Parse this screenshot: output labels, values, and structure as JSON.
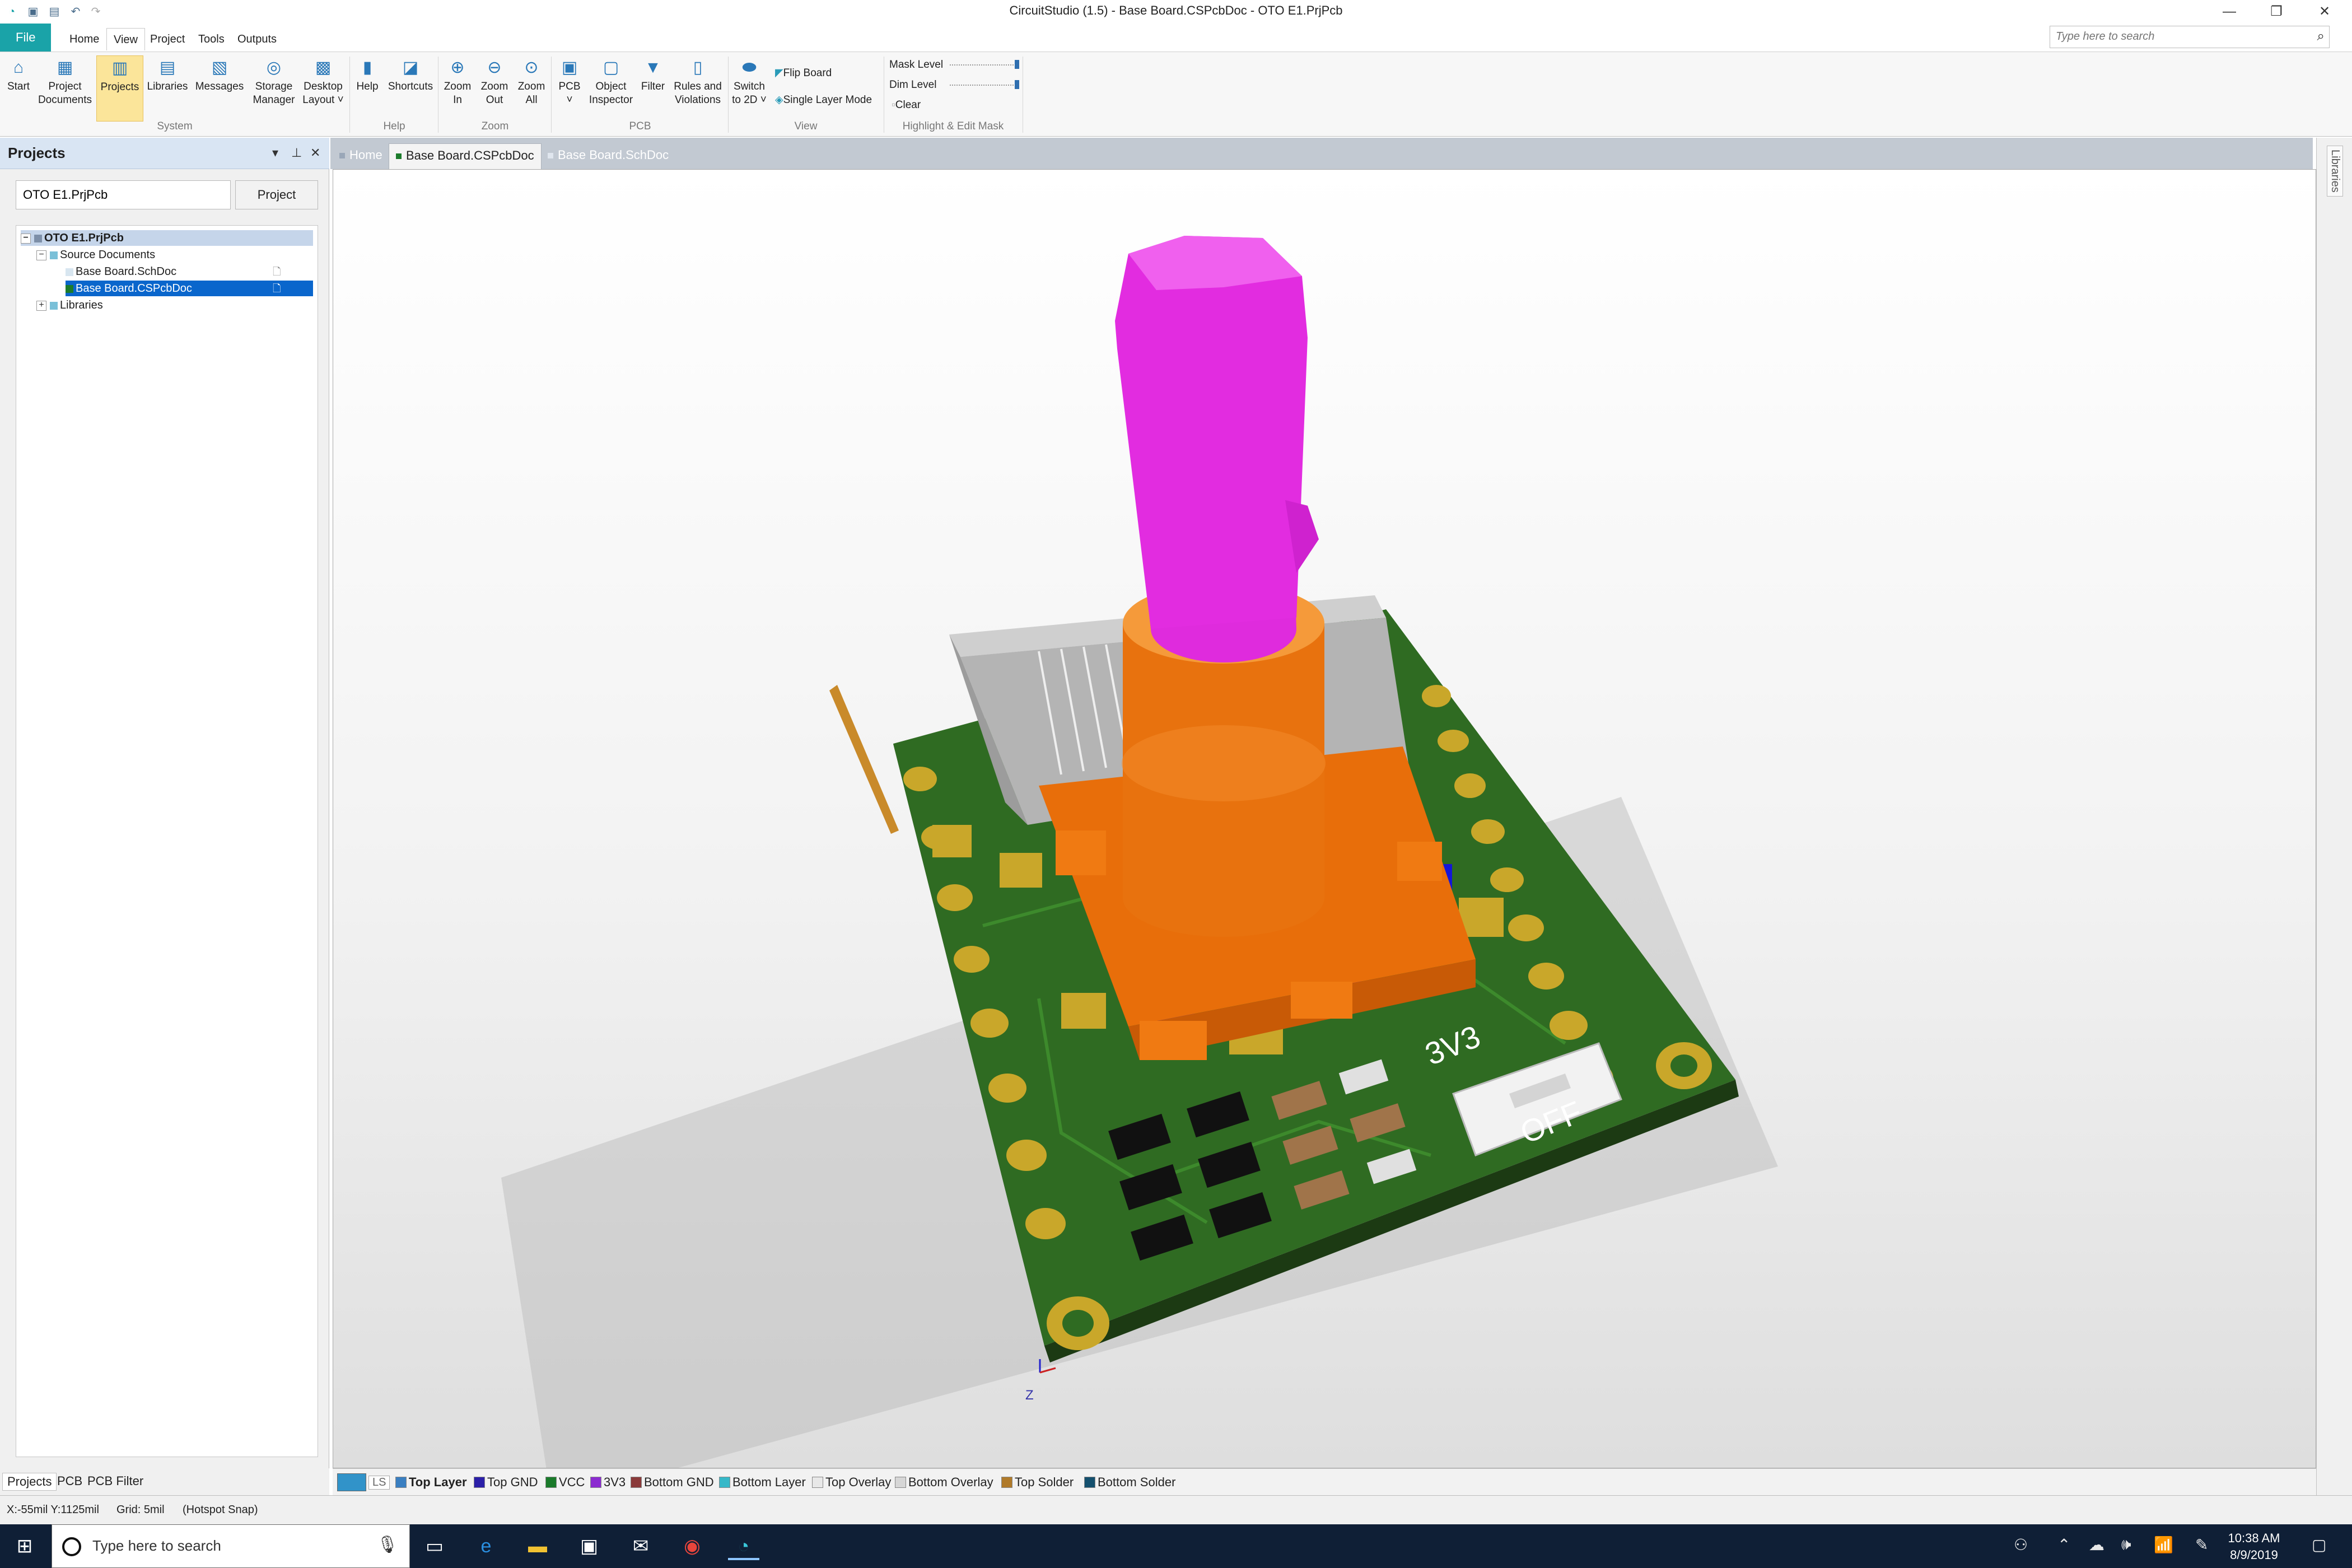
{
  "window": {
    "title": "CircuitStudio (1.5) - Base Board.CSPcbDoc - OTO E1.PrjPcb",
    "controls": [
      "minimize-icon",
      "restore-icon",
      "close-icon"
    ]
  },
  "quick_access": [
    "app-logo-icon",
    "new-icon",
    "save-icon",
    "undo-icon",
    "redo-icon"
  ],
  "menu": {
    "file": "File",
    "tabs": [
      "Home",
      "View",
      "Project",
      "Tools",
      "Outputs"
    ],
    "active_tab": "View"
  },
  "search": {
    "placeholder": "Type here to search"
  },
  "ribbon": {
    "buttons": [
      {
        "label": "Start",
        "icon": "home-icon"
      },
      {
        "label": "Project\nDocuments",
        "icon": "documents-icon"
      },
      {
        "label": "Projects",
        "icon": "projects-icon",
        "active": true
      },
      {
        "label": "Libraries",
        "icon": "libraries-icon"
      },
      {
        "label": "Messages",
        "icon": "messages-icon"
      },
      {
        "label": "Storage\nManager",
        "icon": "storage-icon"
      },
      {
        "label": "Desktop\nLayout ˅",
        "icon": "layout-icon"
      },
      {
        "label": "Help",
        "icon": "help-icon"
      },
      {
        "label": "Shortcuts",
        "icon": "shortcuts-icon"
      },
      {
        "label": "Zoom\nIn",
        "icon": "zoom-in-icon"
      },
      {
        "label": "Zoom\nOut",
        "icon": "zoom-out-icon"
      },
      {
        "label": "Zoom\nAll",
        "icon": "zoom-all-icon"
      },
      {
        "label": "PCB\n˅",
        "icon": "pcb-icon"
      },
      {
        "label": "Object\nInspector",
        "icon": "inspector-icon"
      },
      {
        "label": "Filter",
        "icon": "filter-icon"
      },
      {
        "label": "Rules and\nViolations",
        "icon": "rules-icon"
      },
      {
        "label": "Switch\nto 2D ˅",
        "icon": "switch-2d-icon"
      }
    ],
    "view_options": {
      "flip_board": "Flip Board",
      "single_layer_mode": "Single Layer Mode"
    },
    "mask": {
      "mask_level": "Mask Level",
      "dim_level": "Dim Level",
      "clear": "Clear"
    },
    "groups": [
      "System",
      "Help",
      "Zoom",
      "PCB",
      "View",
      "Highlight & Edit Mask"
    ]
  },
  "projects_panel": {
    "title": "Projects",
    "project_field_value": "OTO E1.PrjPcb",
    "project_button": "Project",
    "tree": {
      "root": "OTO E1.PrjPcb",
      "source_documents": "Source Documents",
      "docs": [
        "Base Board.SchDoc",
        "Base Board.CSPcbDoc"
      ],
      "libraries": "Libraries"
    },
    "bottom_tabs": [
      "Projects",
      "PCB",
      "PCB Filter"
    ]
  },
  "doc_tabs": [
    "Home",
    "Base Board.CSPcbDoc",
    "Base Board.SchDoc"
  ],
  "active_doc_tab": "Base Board.CSPcbDoc",
  "pcb_silkscreen": {
    "switch_on": "3V3",
    "switch_off": "OFF",
    "axis_label": "Z"
  },
  "layers": {
    "ls": "LS",
    "items": [
      {
        "name": "Top Layer",
        "color": "#3a7fc1",
        "active": true
      },
      {
        "name": "Top GND",
        "color": "#2b1fa8"
      },
      {
        "name": "VCC",
        "color": "#1a7a2a"
      },
      {
        "name": "3V3",
        "color": "#8b2bd0"
      },
      {
        "name": "Bottom GND",
        "color": "#8a3a3a"
      },
      {
        "name": "Bottom Layer",
        "color": "#36b8c8"
      },
      {
        "name": "Top Overlay",
        "color": "#e8e8e8"
      },
      {
        "name": "Bottom Overlay",
        "color": "#d6d6d6"
      },
      {
        "name": "Top Solder",
        "color": "#b07a2a"
      },
      {
        "name": "Bottom Solder",
        "color": "#14506e"
      }
    ]
  },
  "status": {
    "coords": "X:-55mil Y:1125mil",
    "grid": "Grid: 5mil",
    "snap": "(Hotspot Snap)"
  },
  "taskbar": {
    "search_text": "Type here to search",
    "time": "10:38 AM",
    "date": "8/9/2019",
    "apps": [
      "task-view-icon",
      "edge-icon",
      "file-explorer-icon",
      "store-icon",
      "mail-icon",
      "chrome-icon",
      "circuitstudio-icon"
    ],
    "tray": [
      "people-icon",
      "chevron-up-icon",
      "onedrive-icon",
      "volume-icon",
      "network-icon",
      "pen-icon",
      "notifications-icon"
    ]
  },
  "colors": {
    "accent": "#1aa3a8",
    "pcb_green": "#2f6b22",
    "knob_magenta": "#e22ce0",
    "encoder_orange": "#f07a12",
    "pad_gold": "#c9a72a",
    "selection_blue": "#0a66cc"
  }
}
